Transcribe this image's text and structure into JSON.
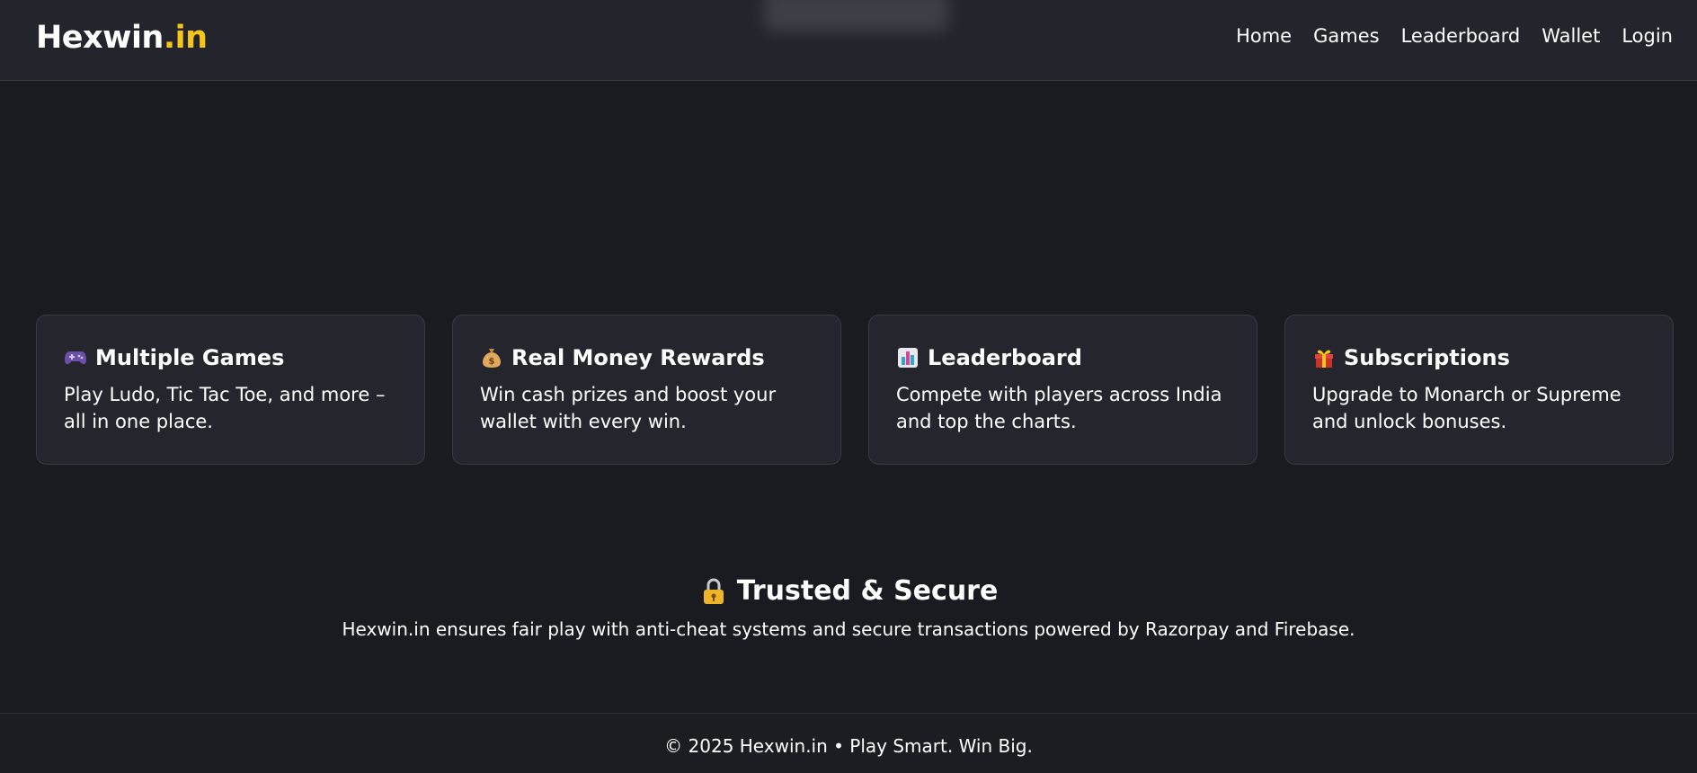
{
  "header": {
    "brand_main": "Hexwin",
    "brand_tld": ".in",
    "nav": [
      "Home",
      "Games",
      "Leaderboard",
      "Wallet",
      "Login"
    ]
  },
  "features": [
    {
      "icon": "gamepad-icon",
      "title": "Multiple Games",
      "desc": "Play Ludo, Tic Tac Toe, and more – all in one place."
    },
    {
      "icon": "money-bag-icon",
      "title": "Real Money Rewards",
      "desc": "Win cash prizes and boost your wallet with every win."
    },
    {
      "icon": "bar-chart-icon",
      "title": "Leaderboard",
      "desc": "Compete with players across India and top the charts."
    },
    {
      "icon": "gift-icon",
      "title": "Subscriptions",
      "desc": "Upgrade to Monarch or Supreme and unlock bonuses."
    }
  ],
  "trust": {
    "icon": "lock-icon",
    "title": "Trusted & Secure",
    "desc": "Hexwin.in ensures fair play with anti-cheat systems and secure transactions powered by Razorpay and Firebase."
  },
  "footer": {
    "text": "© 2025 Hexwin.in • Play Smart. Win Big."
  },
  "colors": {
    "background": "#1a1b21",
    "card": "#25262d",
    "accent": "#f5c518"
  }
}
